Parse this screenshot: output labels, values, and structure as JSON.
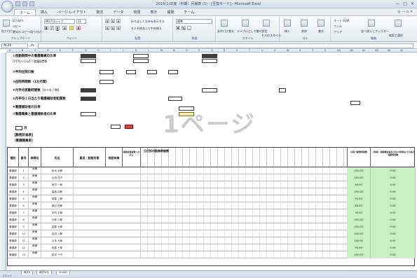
{
  "window": {
    "title": "2016(1)年度（中期）月報表 (1) - [互換モード] - Microsoft Excel",
    "controls": [
      "—",
      "□",
      "✕"
    ]
  },
  "ribbon_tabs": [
    "ホーム",
    "挿入",
    "ページ レイアウト",
    "数式",
    "データ",
    "校閲",
    "表示",
    "開発",
    "チーム"
  ],
  "active_tab": "ホーム",
  "ribbon": {
    "clipboard": {
      "paste": "貼り付け",
      "cut": "切り取り",
      "copy": "コピー",
      "format_painter": "書式のコピー/貼り付け",
      "label": "クリップボード"
    },
    "font": {
      "name": "MS Pゴシック",
      "size": "11",
      "label": "フォント"
    },
    "alignment": {
      "wrap": "折り返して全体を表示する",
      "merge": "セルを結合して中央揃え",
      "label": "配置"
    },
    "number": {
      "format": "標準",
      "label": "数値"
    },
    "styles": {
      "conditional": "条件付き書式",
      "table": "テーブルとして書式設定",
      "cell": "セルのスタイル",
      "label": "スタイル"
    },
    "cells": {
      "insert": "挿入",
      "delete": "削除",
      "format": "書式",
      "label": "セル"
    },
    "editing": {
      "autosum": "オート SUM",
      "fill": "フィル",
      "clear": "クリア",
      "sort": "並べ替えとフィルター",
      "find": "検索と選択",
      "label": "編集"
    }
  },
  "formula_bar": {
    "name_box": "AL20",
    "fx": "fx",
    "value": ""
  },
  "sheet": {
    "watermark": "1ページ",
    "lines": [
      "①夜勤期間中の看護職員の比率",
      "月平均１日当たり看護配置数",
      "②平均在院日数",
      "③在院時間数（1か月間）",
      "④月平均夜勤時間数（①÷①／Ｈ）",
      "⑤月平均１日当たり看護補助者配置数",
      "⑥看護補助者の比率",
      "⑦看護職員と看護補助者の比率",
      "【勤務計画表】",
      "〔看護職員表〕"
    ],
    "month_label": "月",
    "big_label": "1ページ"
  },
  "table": {
    "headers": [
      "種別",
      "番号",
      "病棟名",
      "氏名",
      "雇用・勤務形態",
      "夜勤有無",
      "夜勤従事者数への計上",
      "日付別の勤務時間数",
      "月延べ勤務時間数",
      "（再掲）夜勤専従者及び月16時間以下の者の夜勤時間数"
    ],
    "day_headers": [
      "1日",
      "2日",
      "3日",
      "4日",
      "5日",
      "6日",
      "7日",
      "8日",
      "9日",
      "10日",
      "11日",
      "12日",
      "13日",
      "14日",
      "15日",
      "16日",
      "17日",
      "18日",
      "19日",
      "20日",
      "21日",
      "22日",
      "23日",
      "24日",
      "25日",
      "26日",
      "27日",
      "28日",
      "29日",
      "30日"
    ],
    "rows": [
      {
        "kind": "看護師",
        "no": "1",
        "ward": "病棟",
        "name": "鈴木 太郎",
        "total": "190.00",
        "night": "0.00"
      },
      {
        "kind": "看護師",
        "no": "2",
        "ward": "病棟",
        "name": "山田 花子",
        "total": "190.00",
        "night": "0.00"
      },
      {
        "kind": "看護師",
        "no": "3",
        "ward": "病棟",
        "name": "田中 一郎",
        "total": "60.00",
        "night": "0.00"
      },
      {
        "kind": "看護師",
        "no": "4",
        "ward": "病棟",
        "name": "高橋 次郎",
        "total": "190.00",
        "night": "0.00"
      },
      {
        "kind": "看護師",
        "no": "5",
        "ward": "病棟",
        "name": "伊藤 三郎",
        "total": "90.00",
        "night": "0.00"
      },
      {
        "kind": "看護師",
        "no": "6",
        "ward": "病棟",
        "name": "渡辺 四郎",
        "total": "85.00",
        "night": "0.00"
      },
      {
        "kind": "看護師",
        "no": "7",
        "ward": "病棟",
        "name": "中村 五郎",
        "total": "90.00",
        "night": "0.00"
      },
      {
        "kind": "看護師",
        "no": "8",
        "ward": "病棟",
        "name": "小林 六郎",
        "total": "190.00",
        "night": "0.00"
      },
      {
        "kind": "看護師",
        "no": "9",
        "ward": "病棟",
        "name": "加藤 七郎",
        "total": "190.00",
        "night": "0.00"
      },
      {
        "kind": "看護師",
        "no": "10",
        "ward": "病棟",
        "name": "吉田 八郎",
        "total": "190.00",
        "night": "0.00"
      },
      {
        "kind": "看護師",
        "no": "11",
        "ward": "病棟",
        "name": "山本 九郎",
        "total": "190.00",
        "night": "0.00"
      },
      {
        "kind": "看護師",
        "no": "12",
        "ward": "病棟",
        "name": "佐藤 十郎",
        "total": "90.00",
        "night": "0.00"
      },
      {
        "kind": "看護師",
        "no": "13",
        "ward": "病棟",
        "name": "松本 一子",
        "total": "190.00",
        "night": "0.00"
      }
    ]
  },
  "sheet_tabs": [
    "様式9",
    "様式9(2)",
    "Sheet3"
  ],
  "status": "コマンド"
}
